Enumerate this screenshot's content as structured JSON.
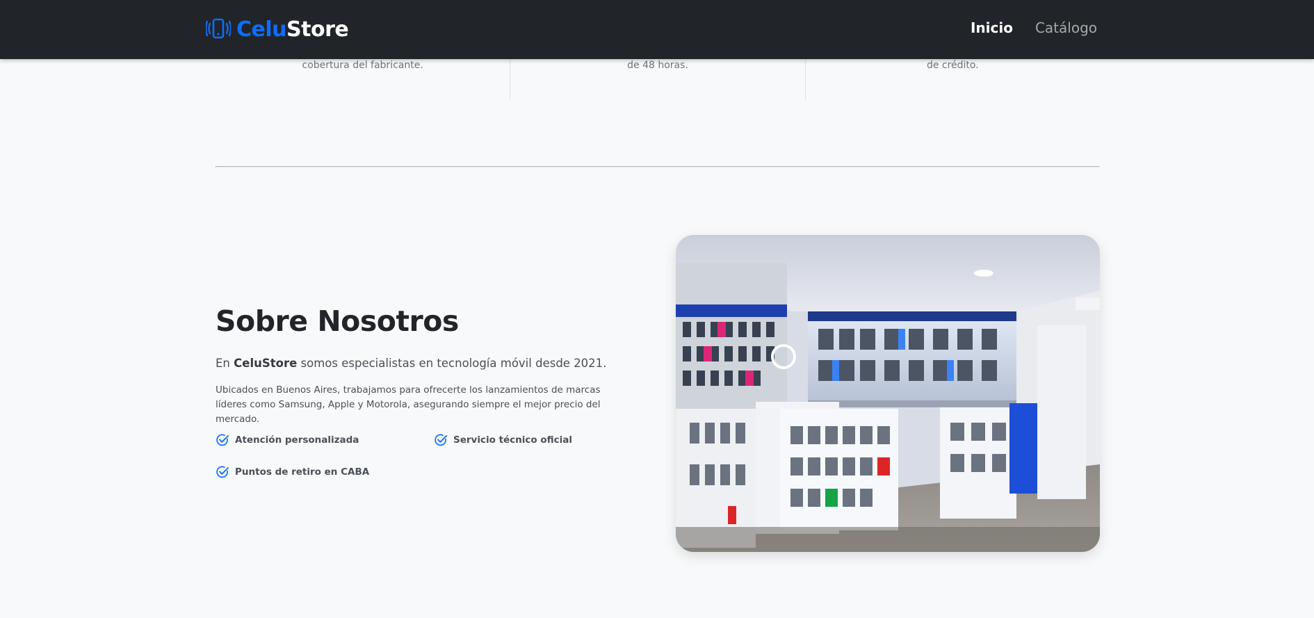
{
  "nav": {
    "brand_part1": "Celu",
    "brand_part2": "Store",
    "links": [
      "Inicio",
      "Catálogo"
    ],
    "active_link": "Inicio"
  },
  "features": [
    "cobertura del fabricante.",
    "de 48 horas.",
    "de crédito."
  ],
  "about": {
    "title": "Sobre Nosotros",
    "lead_prefix": "En",
    "lead_brand": "CeluStore",
    "lead_suffix": "somos especialistas en tecnología móvil desde 2021.",
    "description": "Ubicados en Buenos Aires, trabajamos para ofrecerte los lanzamientos de marcas líderes como Samsung, Apple y Motorola, asegurando siempre el mejor precio del mercado.",
    "checks": [
      "Atención personalizada",
      "Servicio técnico oficial",
      "Puntos de retiro en CABA"
    ]
  },
  "icons": {
    "brand": "phone-vibrate-icon",
    "check": "check-circle-icon"
  },
  "colors": {
    "navbar_bg": "#212529",
    "accent": "#0d6efd",
    "page_bg": "#f8f9fa"
  }
}
